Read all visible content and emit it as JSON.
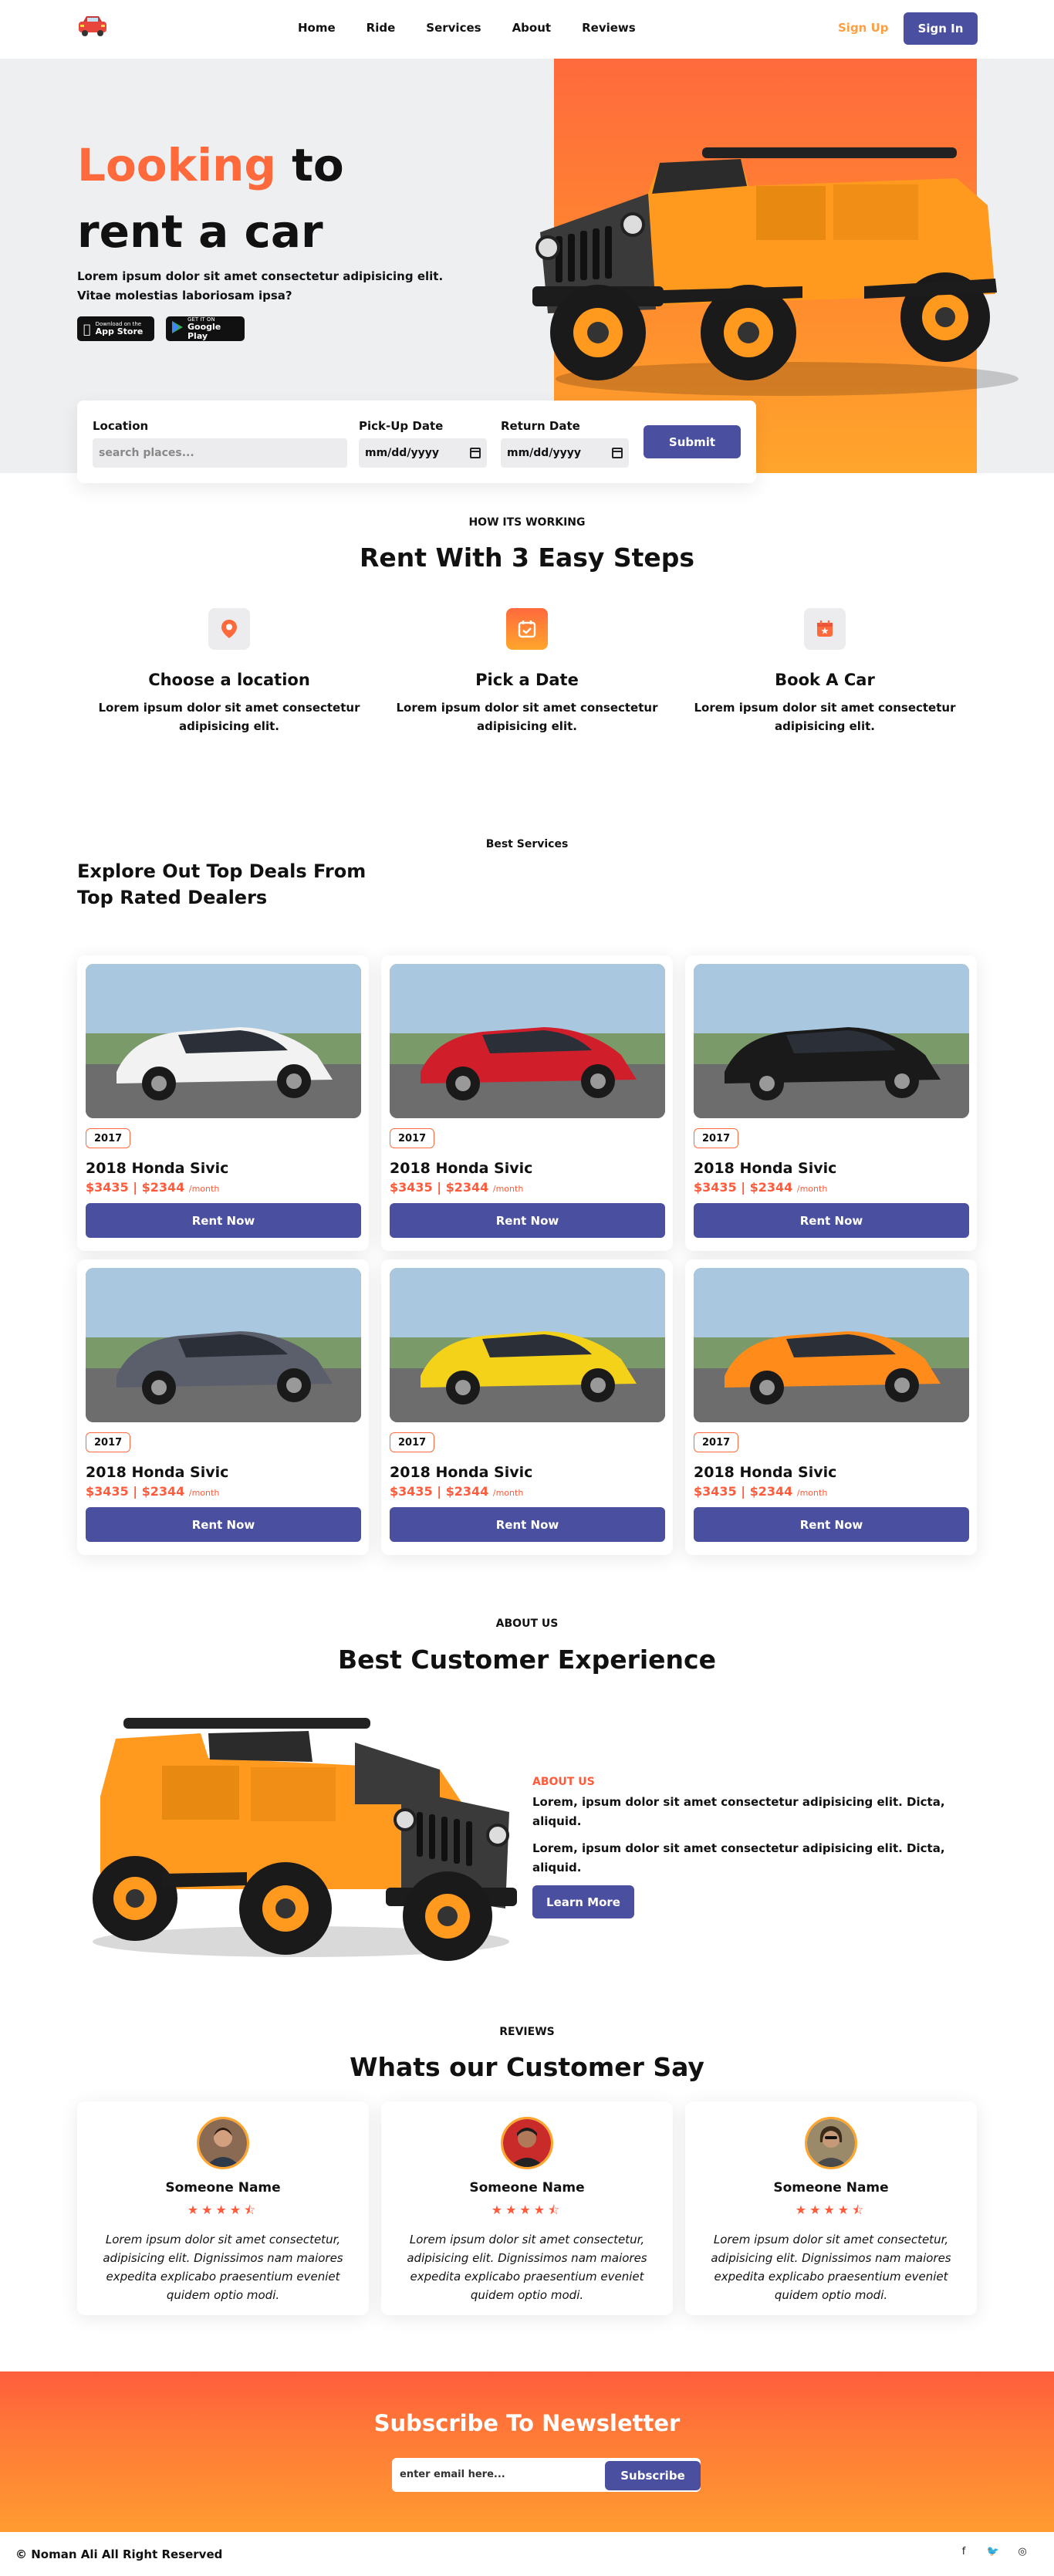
{
  "nav": {
    "links": [
      "Home",
      "Ride",
      "Services",
      "About",
      "Reviews"
    ],
    "sign_up": "Sign Up",
    "sign_in": "Sign In"
  },
  "hero": {
    "title_accent": "Looking",
    "title_rest_1": " to",
    "title_line_2": "rent a car",
    "description": "Lorem ipsum dolor sit amet consectetur adipisicing elit. Vitae molestias laboriosam ipsa?",
    "app_store_small": "Download on the",
    "app_store_big": "App Store",
    "google_play_small": "GET IT ON",
    "google_play_big": "Google Play",
    "search": {
      "location_label": "Location",
      "location_placeholder": "search places...",
      "pickup_label": "Pick-Up Date",
      "pickup_value": "mm/dd/yyyy",
      "return_label": "Return Date",
      "return_value": "mm/dd/yyyy",
      "submit": "Submit"
    }
  },
  "steps": {
    "tag": "HOW ITS WORKING",
    "title": "Rent With 3 Easy Steps",
    "items": [
      {
        "title": "Choose a location",
        "desc": "Lorem ipsum dolor sit amet consectetur adipisicing elit.",
        "icon": "map-pin-icon"
      },
      {
        "title": "Pick a Date",
        "desc": "Lorem ipsum dolor sit amet consectetur adipisicing elit.",
        "icon": "calendar-check-icon"
      },
      {
        "title": "Book A Car",
        "desc": "Lorem ipsum dolor sit amet consectetur adipisicing elit.",
        "icon": "calendar-star-icon"
      }
    ]
  },
  "deals": {
    "tag": "Best Services",
    "title": "Explore Out Top Deals From Top Rated Dealers",
    "cars": [
      {
        "year": "2017",
        "name": "2018 Honda Sivic",
        "price": "$3435 | $2344",
        "unit": "/month",
        "button": "Rent Now",
        "color": "#f2f2f2"
      },
      {
        "year": "2017",
        "name": "2018 Honda Sivic",
        "price": "$3435 | $2344",
        "unit": "/month",
        "button": "Rent Now",
        "color": "#d01f2b"
      },
      {
        "year": "2017",
        "name": "2018 Honda Sivic",
        "price": "$3435 | $2344",
        "unit": "/month",
        "button": "Rent Now",
        "color": "#1a1a1a"
      },
      {
        "year": "2017",
        "name": "2018 Honda Sivic",
        "price": "$3435 | $2344",
        "unit": "/month",
        "button": "Rent Now",
        "color": "#5a5f6b"
      },
      {
        "year": "2017",
        "name": "2018 Honda Sivic",
        "price": "$3435 | $2344",
        "unit": "/month",
        "button": "Rent Now",
        "color": "#f4d21a"
      },
      {
        "year": "2017",
        "name": "2018 Honda Sivic",
        "price": "$3435 | $2344",
        "unit": "/month",
        "button": "Rent Now",
        "color": "#ff8c1a"
      }
    ]
  },
  "about": {
    "tag": "ABOUT US",
    "title": "Best Customer Experience",
    "sub_tag": "ABOUT US",
    "paragraph_1": "Lorem, ipsum dolor sit amet consectetur adipisicing elit. Dicta, aliquid.",
    "paragraph_2": "Lorem, ipsum dolor sit amet consectetur adipisicing elit. Dicta, aliquid.",
    "button": "Learn More"
  },
  "reviews": {
    "tag": "REVIEWS",
    "title": "Whats our Customer Say",
    "items": [
      {
        "name": "Someone Name",
        "stars": "★★★★⯪",
        "text": "Lorem ipsum dolor sit amet consectetur, adipisicing elit. Dignissimos nam maiores expedita explicabo praesentium eveniet quidem optio modi."
      },
      {
        "name": "Someone Name",
        "stars": "★★★★⯪",
        "text": "Lorem ipsum dolor sit amet consectetur, adipisicing elit. Dignissimos nam maiores expedita explicabo praesentium eveniet quidem optio modi."
      },
      {
        "name": "Someone Name",
        "stars": "★★★★⯪",
        "text": "Lorem ipsum dolor sit amet consectetur, adipisicing elit. Dignissimos nam maiores expedita explicabo praesentium eveniet quidem optio modi."
      }
    ]
  },
  "newsletter": {
    "title": "Subscribe To Newsletter",
    "placeholder": "enter email here...",
    "button": "Subscribe"
  },
  "footer": {
    "copyright": "© Noman Ali All Right Reserved",
    "socials": [
      "f",
      "🐦",
      "◎"
    ]
  },
  "colors": {
    "accent": "#ff6a3d",
    "primary": "#4a4f9f",
    "orange": "#ffa52c"
  }
}
